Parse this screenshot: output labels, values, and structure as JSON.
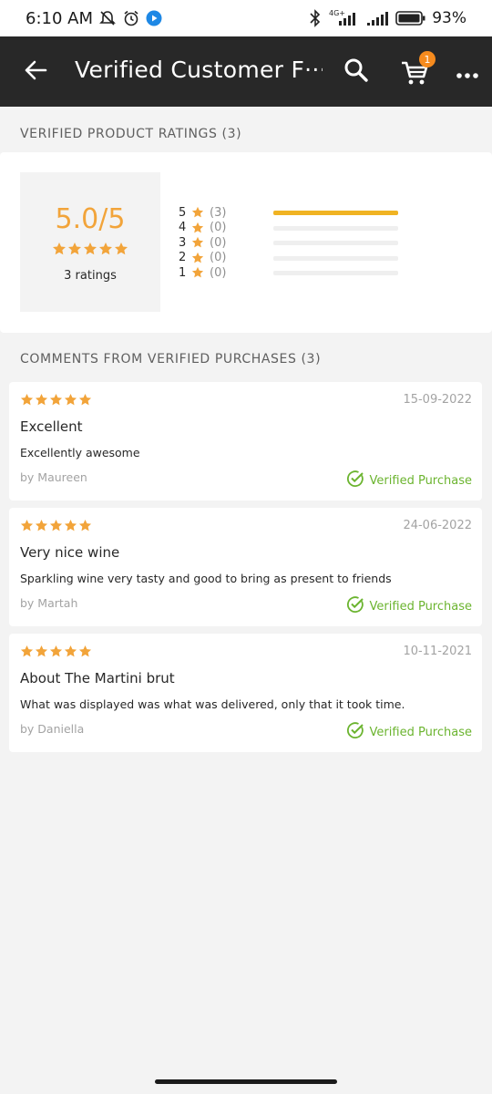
{
  "status_bar": {
    "time": "6:10 AM",
    "network": "4G+",
    "battery": "93%"
  },
  "toolbar": {
    "title": "Verified Customer F···",
    "back_icon": "arrow-left-icon",
    "search_icon": "search-icon",
    "cart_icon": "cart-icon",
    "cart_badge": "1",
    "more_icon": "more-dots-icon"
  },
  "ratings_section": {
    "header": "VERIFIED PRODUCT RATINGS (3)",
    "average": "5.0/5",
    "average_stars": 5,
    "count_label": "3 ratings",
    "distribution": [
      {
        "level": "5",
        "count": "(3)",
        "fraction": 1.0
      },
      {
        "level": "4",
        "count": "(0)",
        "fraction": 0
      },
      {
        "level": "3",
        "count": "(0)",
        "fraction": 0
      },
      {
        "level": "2",
        "count": "(0)",
        "fraction": 0
      },
      {
        "level": "1",
        "count": "(0)",
        "fraction": 0
      }
    ]
  },
  "comments_section": {
    "header": "COMMENTS FROM VERIFIED PURCHASES (3)",
    "reviews": [
      {
        "stars": 5,
        "date": "15-09-2022",
        "title": "Excellent",
        "body": "Excellently awesome",
        "author": "by Maureen",
        "verified_label": "Verified Purchase"
      },
      {
        "stars": 5,
        "date": "24-06-2022",
        "title": "Very nice wine",
        "body": "Sparkling wine very tasty and good to bring as present to friends",
        "author": "by Martah",
        "verified_label": "Verified Purchase"
      },
      {
        "stars": 5,
        "date": "10-11-2021",
        "title": "About The Martini brut",
        "body": "What was displayed was what was delivered, only that it took time.",
        "author": "by Daniella",
        "verified_label": "Verified Purchase"
      }
    ]
  },
  "colors": {
    "toolbar": "#282828",
    "star": "#f2a43a",
    "bar_fill": "#f0b323",
    "verified": "#6bb42f",
    "badge": "#f68b1e"
  }
}
